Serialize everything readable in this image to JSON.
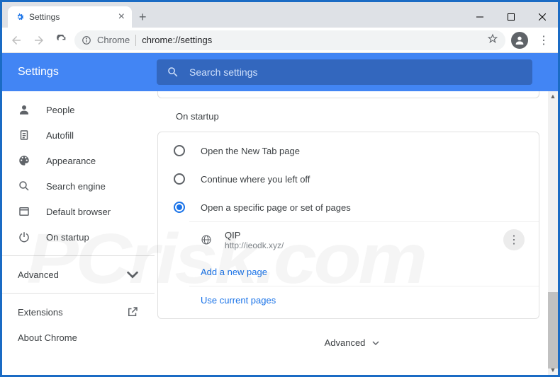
{
  "tab": {
    "title": "Settings"
  },
  "url": {
    "scheme_label": "Chrome",
    "path": "chrome://settings"
  },
  "header": {
    "title": "Settings"
  },
  "search": {
    "placeholder": "Search settings"
  },
  "sidebar": {
    "items": [
      {
        "label": "People"
      },
      {
        "label": "Autofill"
      },
      {
        "label": "Appearance"
      },
      {
        "label": "Search engine"
      },
      {
        "label": "Default browser"
      },
      {
        "label": "On startup"
      }
    ],
    "advanced": "Advanced",
    "extensions": "Extensions",
    "about": "About Chrome"
  },
  "main": {
    "section_title": "On startup",
    "options": [
      "Open the New Tab page",
      "Continue where you left off",
      "Open a specific page or set of pages"
    ],
    "startup_page": {
      "name": "QIP",
      "url": "http://ieodk.xyz/"
    },
    "add_page": "Add a new page",
    "use_current": "Use current pages",
    "advanced_bottom": "Advanced"
  }
}
